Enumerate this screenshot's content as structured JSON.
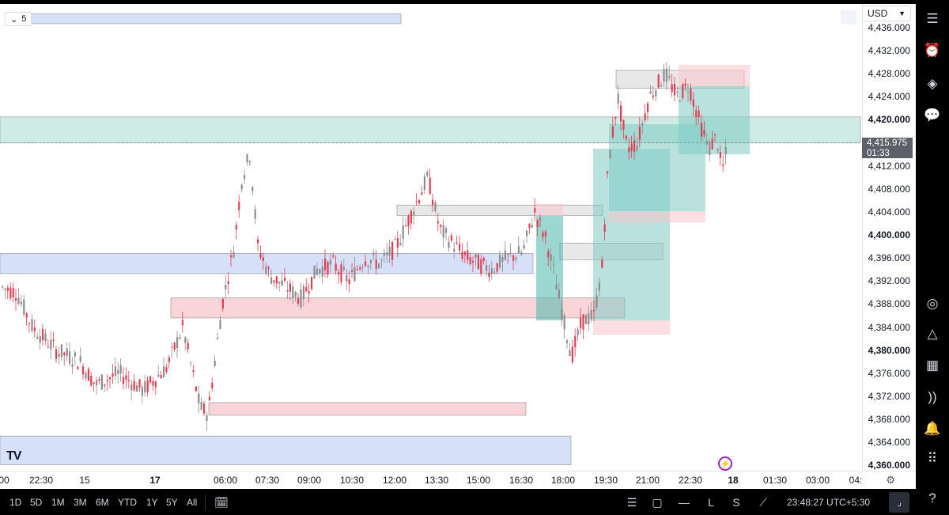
{
  "chart_data": {
    "type": "candlestick",
    "symbol_interval": "5",
    "currency": "USD",
    "last_price": "4,415.975",
    "countdown": "01:33",
    "y_ticks": [
      "4,436.000",
      "4,432.000",
      "4,428.000",
      "4,424.000",
      "4,420.000",
      "4,416.000",
      "4,412.000",
      "4,408.000",
      "4,404.000",
      "4,400.000",
      "4,396.000",
      "4,392.000",
      "4,388.000",
      "4,384.000",
      "4,380.000",
      "4,376.000",
      "4,372.000",
      "4,368.000",
      "4,364.000",
      "4,360.000"
    ],
    "y_ticks_bold": [
      "4,420.000",
      "4,400.000",
      "4,380.000",
      "4,360.000"
    ],
    "x_ticks": [
      "00",
      "22:30",
      "15",
      "17",
      "06:00",
      "07:30",
      "09:00",
      "10:30",
      "12:00",
      "13:30",
      "15:00",
      "16:30",
      "18:00",
      "19:30",
      "21:00",
      "22:30",
      "18",
      "01:30",
      "03:00",
      "04:"
    ],
    "x_ticks_bold": [
      "17",
      "18"
    ],
    "ylim": [
      4358.8,
      4439.4
    ],
    "zones": [
      {
        "kind": "supply",
        "color": "#f7c5cb",
        "price_top": 4438.4,
        "price_bottom": 4436.7,
        "blue": true
      },
      {
        "kind": "imbalance",
        "color": "#bfe4dc",
        "price_top": 4420.5,
        "price_bottom": 4416.0
      },
      {
        "kind": "demand",
        "color": "#c9d6f7",
        "price_top": 4396.8,
        "price_bottom": 4393.3
      },
      {
        "kind": "demand",
        "color": "#f7c5cb",
        "price_top": 4389.1,
        "price_bottom": 4385.6
      },
      {
        "kind": "demand",
        "color": "#f7c5cb",
        "price_top": 4370.9,
        "price_bottom": 4368.7
      },
      {
        "kind": "demand",
        "color": "#c9d6f7",
        "price_top": 4365.1,
        "price_bottom": 4360.1
      },
      {
        "kind": "neutral",
        "color": "#e0e0e0",
        "price_top": 4405.2,
        "price_bottom": 4403.4
      },
      {
        "kind": "neutral",
        "color": "#e0e0e0",
        "price_top": 4398.6,
        "price_bottom": 4395.7
      },
      {
        "kind": "neutral",
        "color": "#e0e0e0",
        "price_top": 4428.6,
        "price_bottom": 4425.5
      }
    ]
  },
  "toolbar": {
    "ranges": [
      "1D",
      "5D",
      "1M",
      "3M",
      "6M",
      "YTD",
      "1Y",
      "5Y",
      "All"
    ],
    "clock": "23:48:27 UTC+5:30"
  },
  "branding": {
    "logo": "TV"
  },
  "icons": {
    "right": [
      "watchlist-icon",
      "alert-clock-icon",
      "layers-icon",
      "chat-icon",
      "gauge-icon",
      "mountain-icon",
      "calendar-icon",
      "broadcast-icon",
      "bell-icon",
      "apps-icon",
      "help-icon"
    ],
    "bottom": [
      "calendar-range-icon",
      "indicators-icon",
      "rectangle-icon",
      "horizontal-line-icon",
      "long-position-icon",
      "short-position-icon",
      "trendline-icon"
    ]
  }
}
